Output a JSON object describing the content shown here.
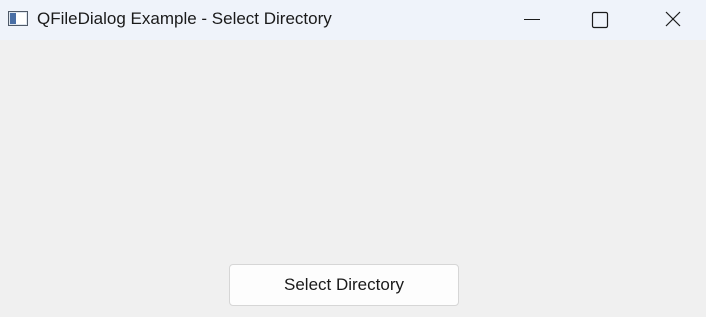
{
  "window": {
    "title": "QFileDialog Example - Select Directory",
    "icon": "qt-app-window-icon",
    "controls": {
      "minimize_icon": "minimize-icon",
      "maximize_icon": "maximize-icon",
      "close_icon": "close-icon"
    }
  },
  "main": {
    "select_button_label": "Select Directory"
  }
}
